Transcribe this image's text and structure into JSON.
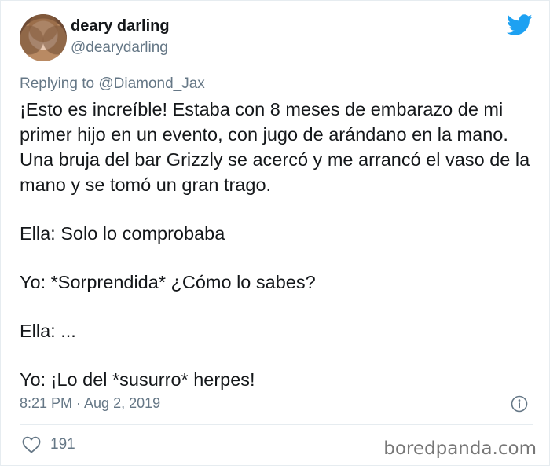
{
  "author": {
    "display_name": "deary darling",
    "handle": "@dearydarling"
  },
  "reply": {
    "prefix": "Replying to",
    "mention": "@Diamond_Jax"
  },
  "tweet": {
    "paragraphs": [
      "¡Esto es increíble! Estaba con 8 meses de embarazo de mi primer hijo en un evento, con jugo de arándano en la mano. Una bruja del bar Grizzly se acercó y me arrancó el vaso de la mano y se tomó un gran trago.",
      "Ella: Solo lo comprobaba",
      "Yo: *Sorprendida* ¿Cómo lo sabes?",
      "Ella: ...",
      "Yo: ¡Lo del *susurro* herpes!"
    ]
  },
  "meta": {
    "timestamp": "8:21 PM · Aug 2, 2019"
  },
  "actions": {
    "like_count": "191"
  },
  "watermark": "boredpanda.com",
  "colors": {
    "twitter_blue": "#1da1f2",
    "secondary_text": "#657786",
    "primary_text": "#14171a"
  },
  "icons": [
    "twitter-bird-icon",
    "info-icon",
    "heart-icon"
  ]
}
